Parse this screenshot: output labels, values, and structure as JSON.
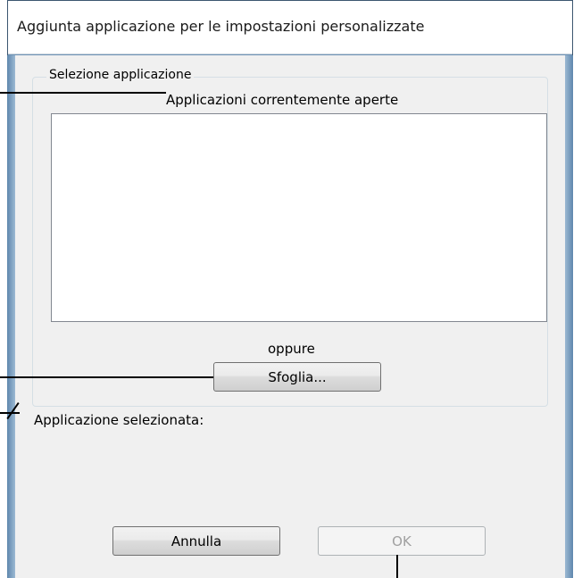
{
  "window": {
    "title": "Aggiunta applicazione per le impostazioni personalizzate"
  },
  "group": {
    "label": "Selezione applicazione",
    "list_label": "Applicazioni correntemente aperte",
    "open_apps": [],
    "or_text": "oppure",
    "browse_label": "Sfoglia..."
  },
  "selected_label": "Applicazione selezionata:",
  "buttons": {
    "cancel_label": "Annulla",
    "ok_label": "OK",
    "ok_enabled": false
  }
}
